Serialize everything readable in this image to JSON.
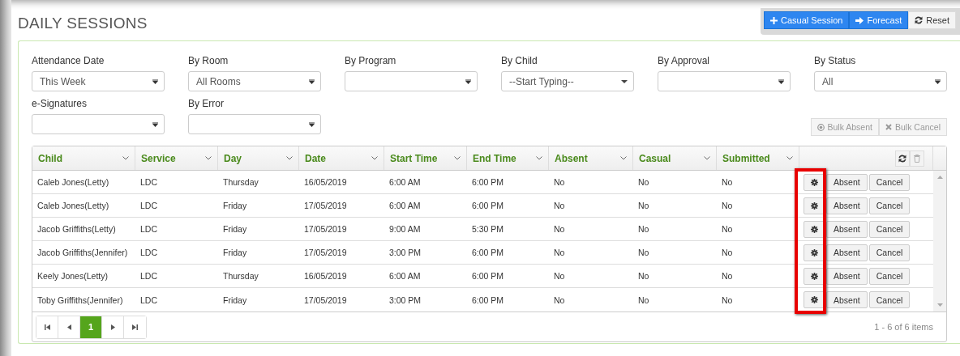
{
  "page": {
    "title": "DAILY SESSIONS"
  },
  "toolbar": [
    {
      "label": "Casual Session",
      "kind": "plus"
    },
    {
      "label": "Forecast",
      "kind": "arrow"
    },
    {
      "label": "Reset",
      "kind": "refresh"
    }
  ],
  "filters": [
    {
      "label": "Attendance Date",
      "value": "This Week",
      "kind": "select"
    },
    {
      "label": "By Room",
      "value": "All Rooms",
      "kind": "select"
    },
    {
      "label": "By Program",
      "kind": "select"
    },
    {
      "label": "By Child",
      "value": "--Start Typing--",
      "kind": "combo"
    },
    {
      "label": "By Approval",
      "kind": "select"
    },
    {
      "label": "By Status",
      "value": "All",
      "kind": "select"
    },
    {
      "label": "e-Signatures",
      "kind": "select"
    },
    {
      "label": "By Error",
      "kind": "select"
    }
  ],
  "bulk_actions": [
    {
      "label": "Bulk Absent",
      "kind": "absent",
      "disabled": true
    },
    {
      "label": "Bulk Cancel",
      "kind": "cancel",
      "disabled": true
    }
  ],
  "table": {
    "columns": [
      "Child",
      "Service",
      "Day",
      "Date",
      "Start Time",
      "End Time",
      "Absent",
      "Casual",
      "Submitted"
    ],
    "rows": [
      {
        "cells": [
          "Caleb Jones(Letty)",
          "LDC",
          "Thursday",
          "16/05/2019",
          "6:00 AM",
          "6:00 PM",
          "No",
          "No",
          "No"
        ],
        "actions": [
          "Absent",
          "Cancel"
        ]
      },
      {
        "cells": [
          "Caleb Jones(Letty)",
          "LDC",
          "Friday",
          "17/05/2019",
          "6:00 AM",
          "6:00 PM",
          "No",
          "No",
          "No"
        ],
        "actions": [
          "Absent",
          "Cancel"
        ]
      },
      {
        "cells": [
          "Jacob Griffiths(Letty)",
          "LDC",
          "Friday",
          "17/05/2019",
          "9:00 AM",
          "5:30 PM",
          "No",
          "No",
          "No"
        ],
        "actions": [
          "Absent",
          "Cancel"
        ]
      },
      {
        "cells": [
          "Jacob Griffiths(Jennifer)",
          "LDC",
          "Friday",
          "17/05/2019",
          "3:00 PM",
          "6:00 PM",
          "No",
          "No",
          "No"
        ],
        "actions": [
          "Absent",
          "Cancel"
        ]
      },
      {
        "cells": [
          "Keely Jones(Letty)",
          "LDC",
          "Thursday",
          "16/05/2019",
          "6:00 AM",
          "6:00 PM",
          "No",
          "No",
          "No"
        ],
        "actions": [
          "Absent",
          "Cancel"
        ]
      },
      {
        "cells": [
          "Toby Griffiths(Jennifer)",
          "LDC",
          "Friday",
          "17/05/2019",
          "3:00 PM",
          "6:00 PM",
          "No",
          "No",
          "No"
        ],
        "actions": [
          "Absent",
          "Cancel"
        ]
      }
    ],
    "callout": {
      "kind": "box"
    }
  },
  "pager": {
    "pages": [
      {
        "label": "1",
        "selected": true
      }
    ],
    "summary": "1 - 6 of 6 items"
  }
}
